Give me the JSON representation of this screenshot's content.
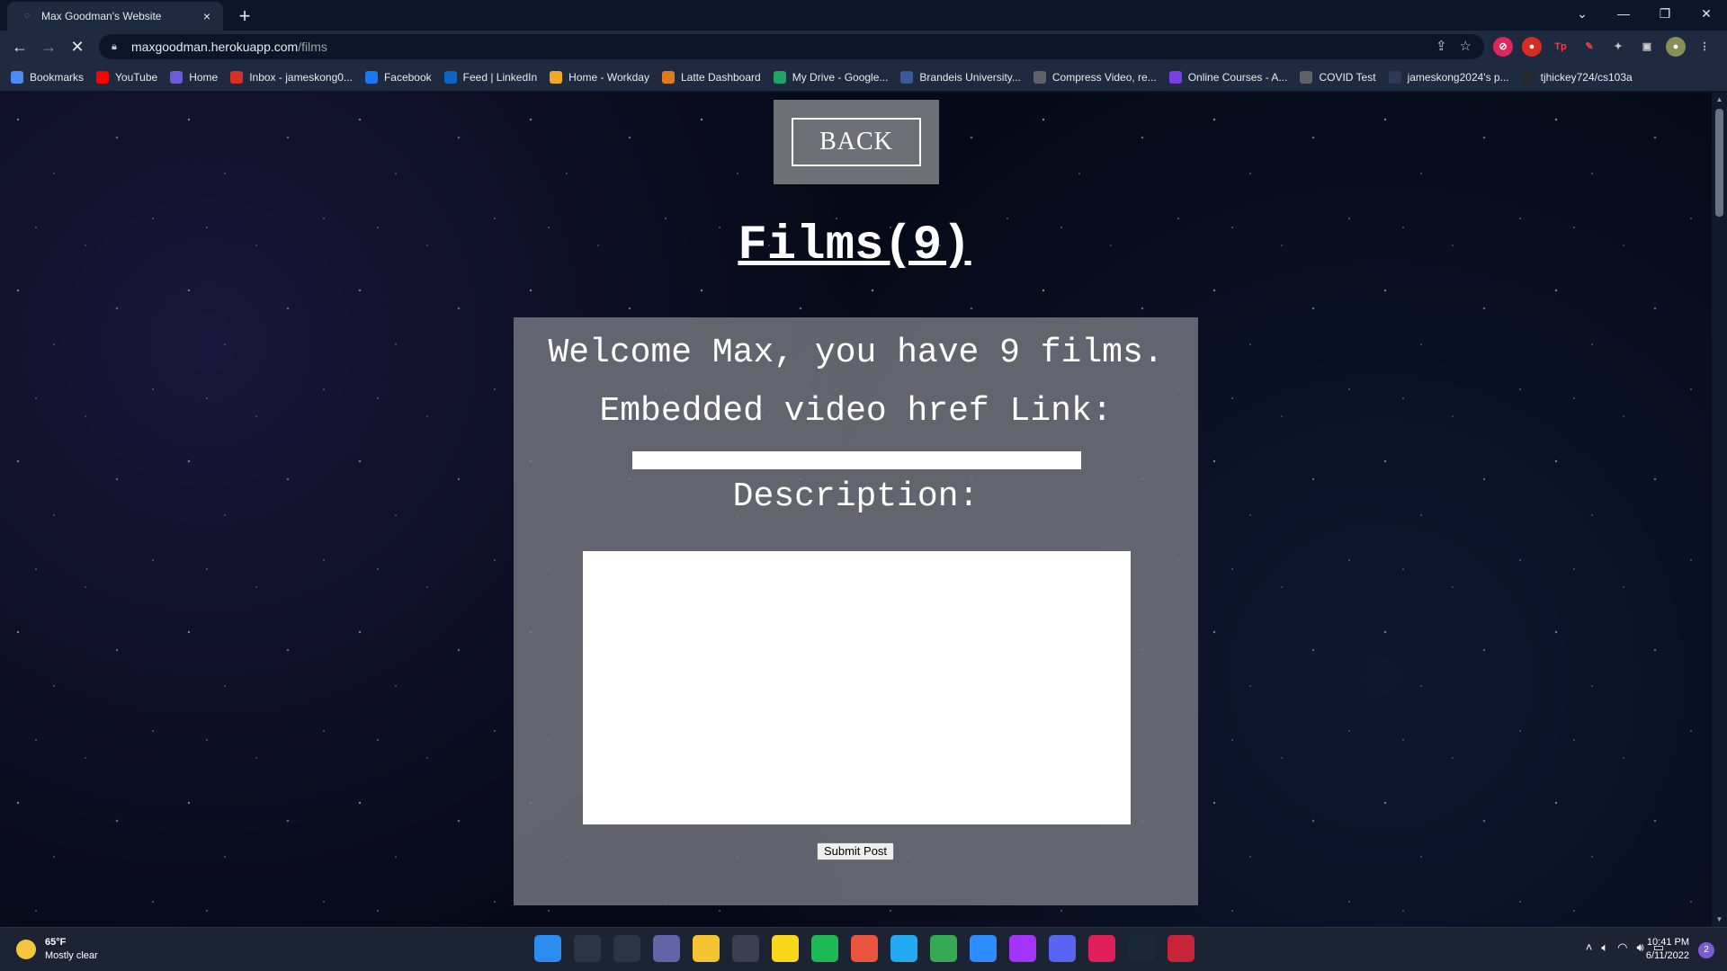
{
  "browser": {
    "tab_title": "Max Goodman's Website",
    "url_host": "maxgoodman.herokuapp.com",
    "url_path": "/films"
  },
  "bookmarks": [
    {
      "label": "Bookmarks",
      "icon": "star-icon",
      "color": "#4c8bf5"
    },
    {
      "label": "YouTube",
      "icon": "youtube-icon",
      "color": "#ff0000"
    },
    {
      "label": "Home",
      "icon": "moon-icon",
      "color": "#6b5bd6"
    },
    {
      "label": "Inbox - jameskong0...",
      "icon": "gmail-icon",
      "color": "#d93025"
    },
    {
      "label": "Facebook",
      "icon": "facebook-icon",
      "color": "#1877f2"
    },
    {
      "label": "Feed | LinkedIn",
      "icon": "linkedin-icon",
      "color": "#0a66c2"
    },
    {
      "label": "Home - Workday",
      "icon": "workday-icon",
      "color": "#f5a623"
    },
    {
      "label": "Latte Dashboard",
      "icon": "latte-icon",
      "color": "#e07b1a"
    },
    {
      "label": "My Drive - Google...",
      "icon": "drive-icon",
      "color": "#1fa463"
    },
    {
      "label": "Brandeis University...",
      "icon": "brandeis-icon",
      "color": "#3a5a9b"
    },
    {
      "label": "Compress Video, re...",
      "icon": "compress-icon",
      "color": "#5f6368"
    },
    {
      "label": "Online Courses - A...",
      "icon": "courses-icon",
      "color": "#7b3fe4"
    },
    {
      "label": "COVID Test",
      "icon": "globe-icon",
      "color": "#5f6368"
    },
    {
      "label": "jameskong2024's p...",
      "icon": "page-icon",
      "color": "#2b3a55"
    },
    {
      "label": "tjhickey724/cs103a",
      "icon": "github-icon",
      "color": "#24292e"
    }
  ],
  "page": {
    "back_label": "BACK",
    "title": "Films(9)",
    "welcome_text": "Welcome Max, you have 9 films.",
    "href_label": "Embedded video href Link:",
    "href_value": "",
    "description_label": "Description:",
    "description_value": "",
    "submit_label": "Submit Post"
  },
  "taskbar": {
    "temperature": "65°F",
    "weather_desc": "Mostly clear",
    "time": "10:41 PM",
    "date": "6/11/2022",
    "notification_count": "2",
    "apps": [
      {
        "name": "windows-start-icon",
        "color": "#2a8cf0"
      },
      {
        "name": "search-icon",
        "color": "#2c3446"
      },
      {
        "name": "task-view-icon",
        "color": "#2c3446"
      },
      {
        "name": "teams-chat-icon",
        "color": "#6264a7"
      },
      {
        "name": "file-explorer-icon",
        "color": "#f4c430"
      },
      {
        "name": "app-icon",
        "color": "#3a4052"
      },
      {
        "name": "sticky-notes-icon",
        "color": "#f9d71c"
      },
      {
        "name": "spotify-icon",
        "color": "#1db954"
      },
      {
        "name": "git-icon",
        "color": "#e9553e"
      },
      {
        "name": "vscode-icon",
        "color": "#23a9f2"
      },
      {
        "name": "chrome-icon",
        "color": "#34a853"
      },
      {
        "name": "zoom-icon",
        "color": "#2d8cff"
      },
      {
        "name": "messenger-icon",
        "color": "#a334fa"
      },
      {
        "name": "discord-icon",
        "color": "#5865f2"
      },
      {
        "name": "slack-icon",
        "color": "#e01e5a"
      },
      {
        "name": "steam-icon",
        "color": "#1b2838"
      },
      {
        "name": "vivaldi-icon",
        "color": "#c7243a"
      }
    ]
  }
}
